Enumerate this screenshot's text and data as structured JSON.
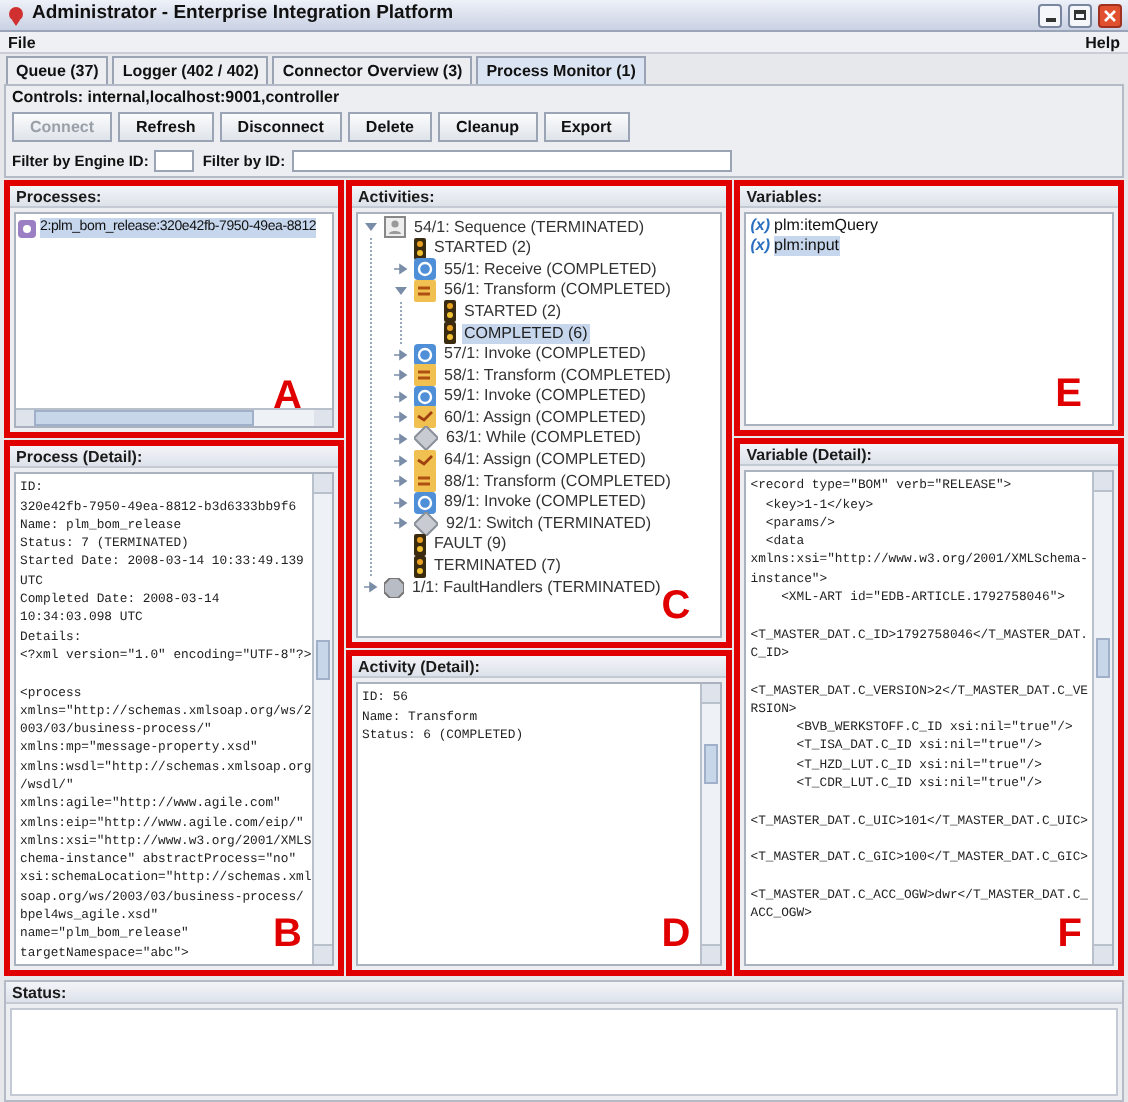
{
  "window": {
    "title": "Administrator - Enterprise Integration Platform"
  },
  "menu": [
    {
      "label": "File"
    },
    {
      "label": "Help"
    }
  ],
  "tabs": [
    {
      "label": "Queue (37)",
      "selected": false
    },
    {
      "label": "Logger (402 / 402)",
      "selected": false
    },
    {
      "label": "Connector Overview (3)",
      "selected": false
    },
    {
      "label": "Process Monitor (1)",
      "selected": true
    }
  ],
  "controls": {
    "label": "Controls: internal,localhost:9001,controller",
    "buttons": [
      {
        "label": "Connect",
        "disabled": true
      },
      {
        "label": "Refresh",
        "disabled": false
      },
      {
        "label": "Disconnect",
        "disabled": false
      },
      {
        "label": "Delete",
        "disabled": false
      },
      {
        "label": "Cleanup",
        "disabled": false
      },
      {
        "label": "Export",
        "disabled": false
      }
    ]
  },
  "filters": [
    {
      "label": "Filter by Engine ID:",
      "kind": "short"
    },
    {
      "label": "Filter by ID:",
      "kind": "long"
    }
  ],
  "processes": {
    "title": "Processes:",
    "marker": "A",
    "items": [
      {
        "label": "2:plm_bom_release:320e42fb-7950-49ea-8812",
        "selected": true
      }
    ]
  },
  "process_detail": {
    "title": "Process (Detail):",
    "marker": "B",
    "paragraphs": [
      [
        "ID:",
        "320e42fb-7950-49ea-8812-b3d6333bb9f6",
        "Name: plm_bom_release",
        "Status: 7 (TERMINATED)",
        "Started Date: 2008-03-14 10:33:49.139",
        "UTC",
        "Completed Date: 2008-03-14",
        "10:34:03.098 UTC",
        "Details:",
        "<?xml version=\"1.0\" encoding=\"UTF-8\"?>"
      ],
      [
        "<process",
        "xmlns=\"http://schemas.xmlsoap.org/ws/2",
        "003/03/business-process/\"",
        "xmlns:mp=\"message-property.xsd\"",
        "xmlns:wsdl=\"http://schemas.xmlsoap.org",
        "/wsdl/\"",
        "xmlns:agile=\"http://www.agile.com\"",
        "xmlns:eip=\"http://www.agile.com/eip/\"",
        "xmlns:xsi=\"http://www.w3.org/2001/XMLS",
        "chema-instance\" abstractProcess=\"no\"",
        "xsi:schemaLocation=\"http://schemas.xml",
        "soap.org/ws/2003/03/business-process/",
        "bpel4ws_agile.xsd\"",
        "name=\"plm_bom_release\"",
        "targetNamespace=\"abc\">"
      ]
    ]
  },
  "activities": {
    "title": "Activities:",
    "marker": "C",
    "tree": [
      {
        "label": "54/1: Sequence (TERMINATED)",
        "kind": "sequence",
        "expanded": true,
        "selected": false,
        "children": [
          {
            "label": "STARTED (2)",
            "kind": "state",
            "selected": false
          },
          {
            "label": "55/1: Receive (COMPLETED)",
            "kind": "receive",
            "expanded": false,
            "selected": false
          },
          {
            "label": "56/1: Transform (COMPLETED)",
            "kind": "transform",
            "expanded": true,
            "selected": false,
            "children": [
              {
                "label": "STARTED (2)",
                "kind": "state",
                "selected": false
              },
              {
                "label": "COMPLETED (6)",
                "kind": "state",
                "selected": true
              }
            ]
          },
          {
            "label": "57/1: Invoke (COMPLETED)",
            "kind": "invoke",
            "expanded": false,
            "selected": false
          },
          {
            "label": "58/1: Transform (COMPLETED)",
            "kind": "transform",
            "expanded": false,
            "selected": false
          },
          {
            "label": "59/1: Invoke (COMPLETED)",
            "kind": "invoke",
            "expanded": false,
            "selected": false
          },
          {
            "label": "60/1: Assign (COMPLETED)",
            "kind": "assign",
            "expanded": false,
            "selected": false
          },
          {
            "label": "63/1: While (COMPLETED)",
            "kind": "while",
            "expanded": false,
            "selected": false
          },
          {
            "label": "64/1: Assign (COMPLETED)",
            "kind": "assign",
            "expanded": false,
            "selected": false
          },
          {
            "label": "88/1: Transform (COMPLETED)",
            "kind": "transform",
            "expanded": false,
            "selected": false
          },
          {
            "label": "89/1: Invoke (COMPLETED)",
            "kind": "invoke",
            "expanded": false,
            "selected": false
          },
          {
            "label": "92/1: Switch (TERMINATED)",
            "kind": "switch",
            "expanded": false,
            "selected": false
          },
          {
            "label": "FAULT (9)",
            "kind": "state",
            "selected": false
          },
          {
            "label": "TERMINATED (7)",
            "kind": "state",
            "selected": false
          }
        ]
      },
      {
        "label": "1/1: FaultHandlers (TERMINATED)",
        "kind": "faulthandlers",
        "expanded": false,
        "selected": false
      }
    ]
  },
  "activity_detail": {
    "title": "Activity (Detail):",
    "marker": "D",
    "paragraphs": [
      [
        "ID: 56",
        "Name: Transform",
        "Status: 6 (COMPLETED)"
      ]
    ]
  },
  "variables": {
    "title": "Variables:",
    "marker": "E",
    "items": [
      {
        "icon_text": "(x)",
        "label": "plm:itemQuery",
        "selected": false
      },
      {
        "icon_text": "(x)",
        "label": "plm:input",
        "selected": true
      }
    ]
  },
  "variable_detail": {
    "title": "Variable (Detail):",
    "marker": "F",
    "paragraphs": [
      [
        "<record type=\"BOM\" verb=\"RELEASE\">",
        "  <key>1-1</key>",
        "  <params/>",
        "  <data",
        "xmlns:xsi=\"http://www.w3.org/2001/XMLSchema-",
        "instance\">",
        "    <XML-ART id=\"EDB-ARTICLE.1792758046\">"
      ],
      [
        "<T_MASTER_DAT.C_ID>1792758046</T_MASTER_DAT.",
        "C_ID>"
      ],
      [
        "<T_MASTER_DAT.C_VERSION>2</T_MASTER_DAT.C_VE",
        "RSION>",
        "      <BVB_WERKSTOFF.C_ID xsi:nil=\"true\"/>",
        "      <T_ISA_DAT.C_ID xsi:nil=\"true\"/>",
        "      <T_HZD_LUT.C_ID xsi:nil=\"true\"/>",
        "      <T_CDR_LUT.C_ID xsi:nil=\"true\"/>"
      ],
      [
        "<T_MASTER_DAT.C_UIC>101</T_MASTER_DAT.C_UIC>"
      ],
      [
        "<T_MASTER_DAT.C_GIC>100</T_MASTER_DAT.C_GIC>"
      ],
      [
        "<T_MASTER_DAT.C_ACC_OGW>dwr</T_MASTER_DAT.C_",
        "ACC_OGW>"
      ]
    ]
  },
  "status_bar": {
    "label": "Status:"
  }
}
